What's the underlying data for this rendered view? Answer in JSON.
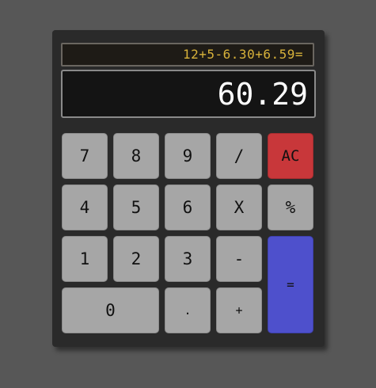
{
  "display": {
    "expression": "12+5-6.30+6.59=",
    "result": "60.29"
  },
  "keys": {
    "seven": "7",
    "eight": "8",
    "nine": "9",
    "divide": "/",
    "clear": "AC",
    "four": "4",
    "five": "5",
    "six": "6",
    "multiply": "X",
    "percent": "%",
    "one": "1",
    "two": "2",
    "three": "3",
    "minus": "-",
    "equals": "=",
    "zero": "0",
    "decimal": ".",
    "plus": "+"
  },
  "colors": {
    "background": "#575757",
    "body": "#2a2a2a",
    "key": "#a6a6a6",
    "clear_key": "#c8373a",
    "equals_key": "#4e50cc",
    "expression_text": "#d8b23a"
  }
}
